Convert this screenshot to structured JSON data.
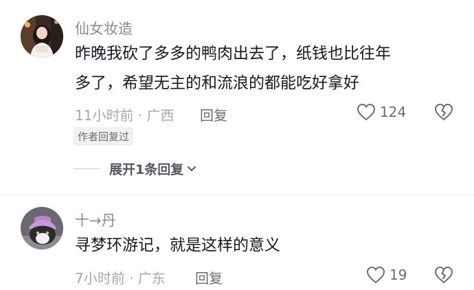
{
  "comments": [
    {
      "username": "仙女妆造",
      "text": "昨晚我砍了多多的鸭肉出去了，纸钱也比往年多了，希望无主的和流浪的都能吃好拿好",
      "time": "11小时前",
      "location": "广西",
      "reply_label": "回复",
      "like_count": "124",
      "badge": "作者回复过",
      "expand_label": "展开1条回复",
      "avatar_icon": "avatar-photo-girl"
    },
    {
      "username": "十→丹",
      "text": "寻梦环游记，就是这样的意义",
      "time": "7小时前",
      "location": "广东",
      "reply_label": "回复",
      "like_count": "19",
      "avatar_icon": "avatar-photo-cat"
    }
  ],
  "separator": "·",
  "icons": {
    "like": "heart-outline-icon",
    "dislike": "broken-heart-icon",
    "expand": "chevron-down-icon"
  },
  "colors": {
    "text": "#161823",
    "secondary": "#8a8b91",
    "meta": "#a7a8ad",
    "icon": "#6b6c72"
  }
}
